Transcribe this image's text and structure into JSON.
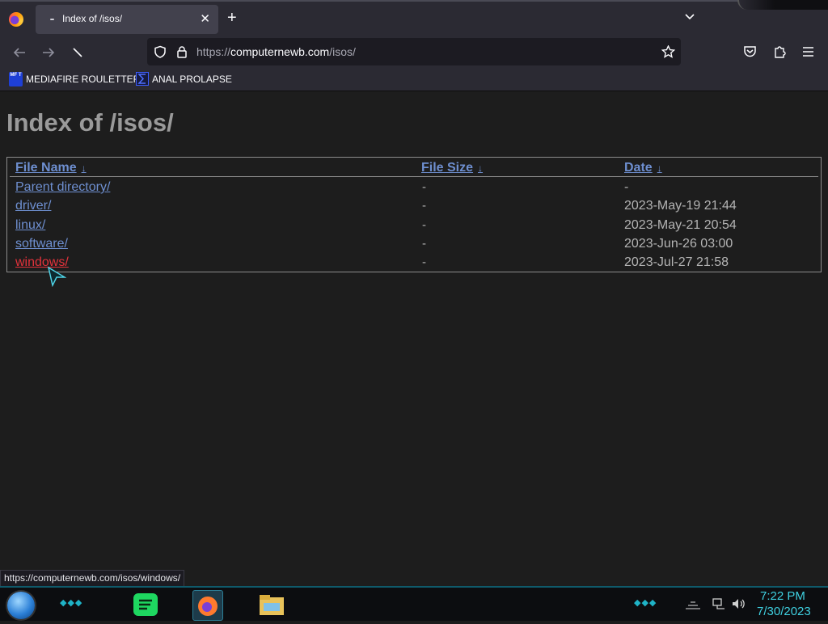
{
  "browser": {
    "tab_title": "Index of /isos/",
    "tab_close": "✕",
    "new_tab": "+",
    "url_scheme": "https://",
    "url_host": "computernewb.com",
    "url_path": "/isos/",
    "bookmarks": [
      {
        "label": "MEDIAFIRE ROULETTER",
        "icon_text": "MF T"
      },
      {
        "label": "ANAL PROLAPSE"
      }
    ],
    "status_url": "https://computernewb.com/isos/windows/"
  },
  "page": {
    "title": "Index of /isos/",
    "headers": {
      "name": "File Name",
      "size": "File Size",
      "date": "Date",
      "sort_arrow": "↓"
    },
    "rows": [
      {
        "name": "Parent directory/",
        "size": "-",
        "date": "-"
      },
      {
        "name": "driver/",
        "size": "-",
        "date": "2023-May-19 21:44"
      },
      {
        "name": "linux/",
        "size": "-",
        "date": "2023-May-21 20:54"
      },
      {
        "name": "software/",
        "size": "-",
        "date": "2023-Jun-26 03:00"
      },
      {
        "name": "windows/",
        "size": "-",
        "date": "2023-Jul-27 21:58"
      }
    ]
  },
  "taskbar": {
    "time": "7:22 PM",
    "date": "7/30/2023"
  },
  "colors": {
    "link": "#6e8fd0",
    "active_link": "#e2323b",
    "clock": "#3fd0e0"
  }
}
